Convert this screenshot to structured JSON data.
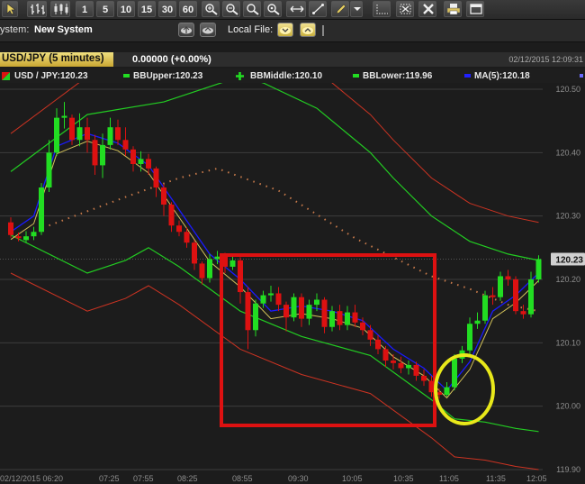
{
  "toolbar": {
    "buttons": [
      {
        "name": "pointer-tool-button",
        "icon": "pointer-icon"
      },
      {
        "name": "bar-chart-button",
        "icon": "bar-chart-icon"
      },
      {
        "name": "candlestick-chart-button",
        "icon": "candlestick-icon"
      },
      {
        "name": "period-1-button",
        "label": "1"
      },
      {
        "name": "period-5-button",
        "label": "5"
      },
      {
        "name": "period-10-button",
        "label": "10"
      },
      {
        "name": "period-15-button",
        "label": "15"
      },
      {
        "name": "period-30-button",
        "label": "30"
      },
      {
        "name": "period-60-button",
        "label": "60"
      },
      {
        "name": "zoom-in-button",
        "icon": "zoom-in-icon"
      },
      {
        "name": "zoom-out-button",
        "icon": "zoom-out-icon"
      },
      {
        "name": "zoom-area-button",
        "icon": "zoom-area-icon"
      },
      {
        "name": "zoom-reset-button",
        "icon": "zoom-reset-icon"
      },
      {
        "name": "horizontal-line-button",
        "icon": "horizontal-arrows-icon"
      },
      {
        "name": "trend-line-button",
        "icon": "trend-line-icon"
      },
      {
        "name": "draw-tool-button",
        "icon": "pencil-icon"
      },
      {
        "name": "draw-tool-dropdown",
        "icon": "chevron-down-icon"
      },
      {
        "name": "dotted-grid-button",
        "icon": "dotted-grid-icon"
      },
      {
        "name": "delete-objects-button",
        "icon": "clear-objects-icon"
      },
      {
        "name": "close-button",
        "icon": "close-icon"
      },
      {
        "name": "print-button",
        "icon": "print-icon"
      },
      {
        "name": "window-button",
        "icon": "window-icon"
      }
    ]
  },
  "system_bar": {
    "label": "ystem:",
    "name": "New System",
    "local_file_label": "Local File:"
  },
  "header": {
    "symbol_title": "USD/JPY (5 minutes)",
    "change": "0.00000 (+0.00%)",
    "timestamp": "02/12/2015 12:09:31"
  },
  "legend": {
    "items": [
      {
        "label": "USD / JPY:120.23",
        "color": "#ffffff",
        "marker": "bicolor-square-icon"
      },
      {
        "label": "BBUpper:120.23",
        "color": "#33ee33",
        "marker": "green-line-icon"
      },
      {
        "label": "BBMiddle:120.10",
        "color": "#33ee33",
        "marker": "plus-icon"
      },
      {
        "label": "BBLower:119.96",
        "color": "#33ee33",
        "marker": "green-line-icon"
      },
      {
        "label": "MA(5):120.18",
        "color": "#1a1aff",
        "marker": "blue-line-icon"
      }
    ]
  },
  "colors": {
    "bull_candle": "#22dd22",
    "bear_candle": "#dd1111",
    "band_inner": "#22cc22",
    "band_outer": "#cc3322",
    "ma_fast": "#1a1aff",
    "ma_slow": "#d4c35a",
    "middle_dots": "#c87a4a",
    "highlight_box": "#dd1111",
    "highlight_circle": "#e8e81a",
    "price_tag_bg": "#d0d0d0"
  },
  "chart_data": {
    "type": "candlestick",
    "symbol": "USD/JPY",
    "current_price_label": "120.23",
    "y_ticks": [
      "120.50",
      "120.40",
      "120.30",
      "120.20",
      "120.10",
      "120.00",
      "119.90"
    ],
    "x_ticks": [
      "02/12/2015 06:20",
      "07:25",
      "07:55",
      "08:25",
      "08:55",
      "09:30",
      "10:05",
      "10:35",
      "11:05",
      "11:35",
      "12:05"
    ],
    "ylim": [
      119.89,
      120.51
    ],
    "candles": [
      [
        120.29,
        120.27,
        120.298,
        120.266
      ],
      [
        120.268,
        120.265,
        120.274,
        120.26
      ],
      [
        120.262,
        120.268,
        120.276,
        120.258
      ],
      [
        120.268,
        120.275,
        120.283,
        120.262
      ],
      [
        120.275,
        120.345,
        120.352,
        120.27
      ],
      [
        120.345,
        120.4,
        120.42,
        120.338
      ],
      [
        120.4,
        120.455,
        120.47,
        120.395
      ],
      [
        120.455,
        120.458,
        120.48,
        120.438
      ],
      [
        120.455,
        120.42,
        120.46,
        120.412
      ],
      [
        120.42,
        120.44,
        120.462,
        120.41
      ],
      [
        120.44,
        120.42,
        120.455,
        120.4
      ],
      [
        120.42,
        120.38,
        120.428,
        120.365
      ],
      [
        120.38,
        120.412,
        120.43,
        120.36
      ],
      [
        120.412,
        120.44,
        120.455,
        120.405
      ],
      [
        120.44,
        120.42,
        120.452,
        120.412
      ],
      [
        120.42,
        120.405,
        120.44,
        120.395
      ],
      [
        120.405,
        120.382,
        120.41,
        120.37
      ],
      [
        120.382,
        120.39,
        120.402,
        120.37
      ],
      [
        120.39,
        120.375,
        120.398,
        120.365
      ],
      [
        120.375,
        120.345,
        120.378,
        120.33
      ],
      [
        120.345,
        120.318,
        120.35,
        120.3
      ],
      [
        120.318,
        120.285,
        120.322,
        120.275
      ],
      [
        120.285,
        120.275,
        120.293,
        120.268
      ],
      [
        120.275,
        120.258,
        120.282,
        120.25
      ],
      [
        120.258,
        120.225,
        120.262,
        120.215
      ],
      [
        120.225,
        120.202,
        120.228,
        120.192
      ],
      [
        120.202,
        120.232,
        120.24,
        120.195
      ],
      [
        120.232,
        120.236,
        120.245,
        120.224
      ],
      [
        120.236,
        120.22,
        120.242,
        120.21
      ],
      [
        120.22,
        120.23,
        120.24,
        120.215
      ],
      [
        120.23,
        120.18,
        120.235,
        120.162
      ],
      [
        120.18,
        120.12,
        120.188,
        120.09
      ],
      [
        120.12,
        120.162,
        120.168,
        120.11
      ],
      [
        120.162,
        120.175,
        120.182,
        120.155
      ],
      [
        120.175,
        120.178,
        120.19,
        120.165
      ],
      [
        120.178,
        120.16,
        120.188,
        120.15
      ],
      [
        120.16,
        120.14,
        120.165,
        120.118
      ],
      [
        120.14,
        120.172,
        120.178,
        120.134
      ],
      [
        120.172,
        120.138,
        120.178,
        120.125
      ],
      [
        120.138,
        120.16,
        120.168,
        120.128
      ],
      [
        120.16,
        120.168,
        120.178,
        120.15
      ],
      [
        120.168,
        120.125,
        120.172,
        120.115
      ],
      [
        120.125,
        120.15,
        120.158,
        120.118
      ],
      [
        120.15,
        120.128,
        120.16,
        120.12
      ],
      [
        120.128,
        120.148,
        120.158,
        120.12
      ],
      [
        120.148,
        120.132,
        120.16,
        120.125
      ],
      [
        120.132,
        120.12,
        120.14,
        120.112
      ],
      [
        120.12,
        120.105,
        120.128,
        120.095
      ],
      [
        120.105,
        120.09,
        120.112,
        120.082
      ],
      [
        120.09,
        120.072,
        120.095,
        120.062
      ],
      [
        120.072,
        120.068,
        120.082,
        120.058
      ],
      [
        120.068,
        120.06,
        120.078,
        120.052
      ],
      [
        120.06,
        120.065,
        120.072,
        120.05
      ],
      [
        120.065,
        120.048,
        120.07,
        120.04
      ],
      [
        120.048,
        120.04,
        120.058,
        120.032
      ],
      [
        120.04,
        120.022,
        120.048,
        120.015
      ],
      [
        120.022,
        120.018,
        120.028,
        120.012
      ],
      [
        120.018,
        120.03,
        120.038,
        120.015
      ],
      [
        120.03,
        120.075,
        120.082,
        120.025
      ],
      [
        120.075,
        120.088,
        120.095,
        120.068
      ],
      [
        120.088,
        120.13,
        120.14,
        120.082
      ],
      [
        120.13,
        120.135,
        120.148,
        120.122
      ],
      [
        120.135,
        120.175,
        120.182,
        120.13
      ],
      [
        120.175,
        120.172,
        120.188,
        120.16
      ],
      [
        120.172,
        120.205,
        120.212,
        120.166
      ],
      [
        120.205,
        120.2,
        120.215,
        120.19
      ],
      [
        120.2,
        120.15,
        120.205,
        120.145
      ],
      [
        120.15,
        120.145,
        120.16,
        120.138
      ],
      [
        120.145,
        120.2,
        120.212,
        120.14
      ],
      [
        120.2,
        120.232,
        120.238,
        120.195
      ]
    ],
    "series": [
      {
        "name": "BBUpper",
        "values": [
          [
            0,
            120.37
          ],
          [
            10,
            120.46
          ],
          [
            20,
            120.48
          ],
          [
            30,
            120.52
          ],
          [
            33,
            120.51
          ],
          [
            40,
            120.47
          ],
          [
            47,
            120.4
          ],
          [
            50,
            120.36
          ],
          [
            55,
            120.3
          ],
          [
            60,
            120.26
          ],
          [
            65,
            120.24
          ],
          [
            69,
            120.23
          ]
        ]
      },
      {
        "name": "BBMiddle",
        "values": [
          [
            5,
            120.285
          ],
          [
            15,
            120.33
          ],
          [
            22,
            120.36
          ],
          [
            27,
            120.375
          ],
          [
            35,
            120.34
          ],
          [
            45,
            120.265
          ],
          [
            55,
            120.205
          ],
          [
            60,
            120.185
          ],
          [
            65,
            120.16
          ],
          [
            69,
            120.15
          ]
        ]
      },
      {
        "name": "BBLower",
        "values": [
          [
            0,
            120.27
          ],
          [
            10,
            120.21
          ],
          [
            15,
            120.23
          ],
          [
            18,
            120.25
          ],
          [
            22,
            120.22
          ],
          [
            30,
            120.15
          ],
          [
            38,
            120.11
          ],
          [
            47,
            120.08
          ],
          [
            55,
            120.01
          ],
          [
            58,
            119.98
          ],
          [
            62,
            119.975
          ],
          [
            66,
            119.965
          ],
          [
            69,
            119.96
          ]
        ]
      },
      {
        "name": "MA(5)",
        "values": [
          [
            0,
            120.275
          ],
          [
            3,
            120.3
          ],
          [
            6,
            120.41
          ],
          [
            10,
            120.43
          ],
          [
            14,
            120.415
          ],
          [
            18,
            120.38
          ],
          [
            22,
            120.31
          ],
          [
            26,
            120.24
          ],
          [
            30,
            120.2
          ],
          [
            34,
            120.15
          ],
          [
            38,
            120.158
          ],
          [
            42,
            120.15
          ],
          [
            46,
            120.135
          ],
          [
            50,
            120.09
          ],
          [
            54,
            120.06
          ],
          [
            57,
            120.025
          ],
          [
            60,
            120.07
          ],
          [
            63,
            120.15
          ],
          [
            66,
            120.175
          ],
          [
            69,
            120.21
          ]
        ]
      }
    ]
  }
}
